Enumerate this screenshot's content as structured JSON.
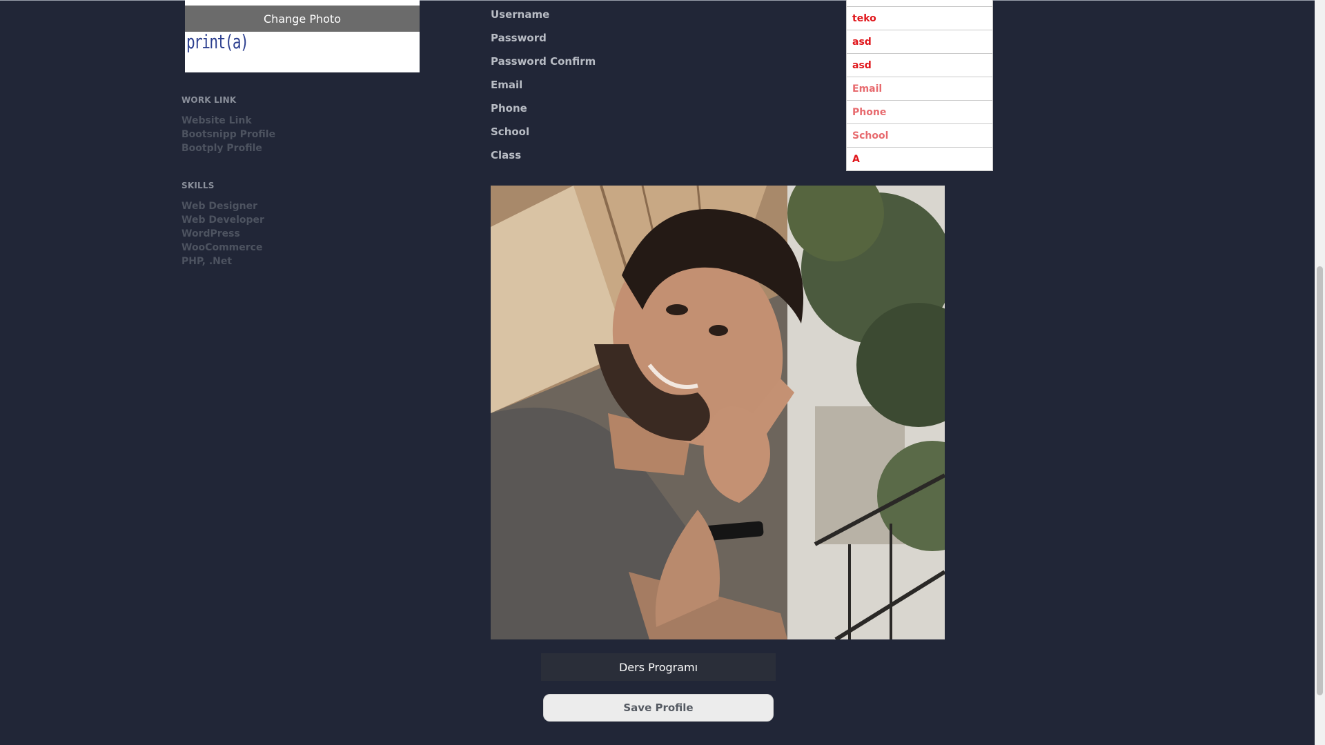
{
  "sidebar": {
    "change_photo_label": "Change Photo",
    "photo_text": "print(a)",
    "work_link": {
      "title": "WORK LINK",
      "items": [
        "Website Link",
        "Bootsnipp Profile",
        "Bootply Profile"
      ]
    },
    "skills": {
      "title": "SKILLS",
      "items": [
        "Web Designer",
        "Web Developer",
        "WordPress",
        "WooCommerce",
        "PHP, .Net"
      ]
    }
  },
  "form": {
    "labels": {
      "username": "Username",
      "password": "Password",
      "password_confirm": "Password Confirm",
      "email": "Email",
      "phone": "Phone",
      "school": "School",
      "class": "Class"
    },
    "values": {
      "username": "teko",
      "password": "asd",
      "password_confirm": "asd",
      "email": "",
      "phone": "",
      "school": "",
      "class": "A"
    },
    "placeholders": {
      "email": "Email",
      "phone": "Phone",
      "school": "School"
    }
  },
  "upload": {
    "label": "Ders Programı"
  },
  "actions": {
    "save_label": "Save Profile"
  },
  "colors": {
    "background": "#212637",
    "input_text": "#e0161b",
    "placeholder": "#e76a6e",
    "sidebar_link": "#4d5360"
  }
}
